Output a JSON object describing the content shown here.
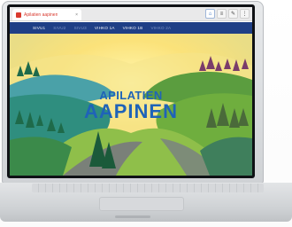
{
  "browser": {
    "tab_title": "Apilatien aapinen",
    "icons": [
      "home-icon",
      "list-icon",
      "pencil-icon",
      "more-icon"
    ],
    "icon_glyphs": [
      "⌂",
      "≡",
      "✎",
      "⋮"
    ]
  },
  "site": {
    "nav": [
      "SIVU1",
      "SIVU2",
      "SIVU3",
      "VIHKO 1A",
      "VIHKO 1B",
      "VIHKO 2A"
    ],
    "title_line1": "APILATIEN",
    "title_line2": "AAPINEN"
  },
  "colors": {
    "nav_bg": "#1f3f86",
    "title": "#1f63b8",
    "tab_accent": "#d93a2f"
  }
}
